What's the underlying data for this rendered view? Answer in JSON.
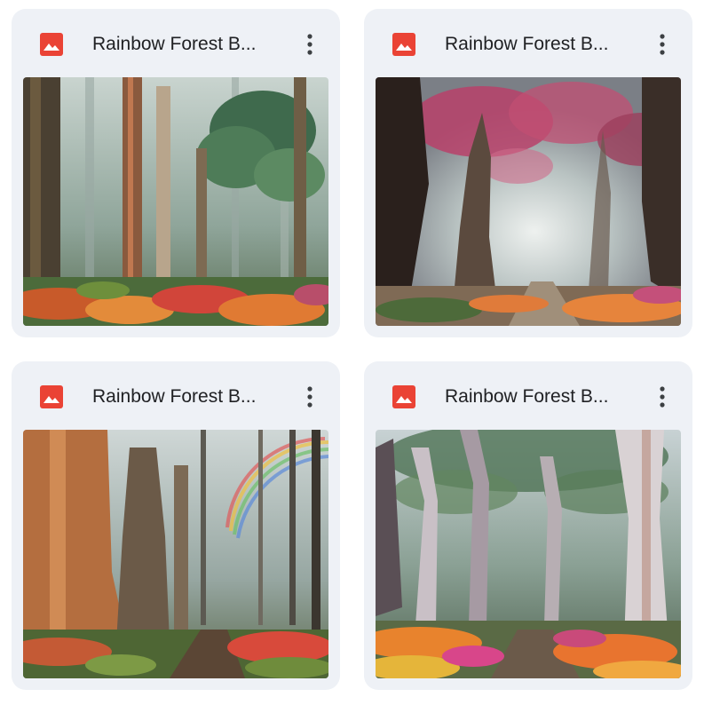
{
  "files": [
    {
      "title": "Rainbow Forest B...",
      "type_icon": "image-file-icon",
      "menu_icon": "more-vert-icon",
      "thumbnail": "tall eucalyptus forest with red and orange undergrowth"
    },
    {
      "title": "Rainbow Forest B...",
      "type_icon": "image-file-icon",
      "menu_icon": "more-vert-icon",
      "thumbnail": "misty path under pink-blossom trees"
    },
    {
      "title": "Rainbow Forest B...",
      "type_icon": "image-file-icon",
      "menu_icon": "more-vert-icon",
      "thumbnail": "giant trunks with rainbow and dirt trail"
    },
    {
      "title": "Rainbow Forest B...",
      "type_icon": "image-file-icon",
      "menu_icon": "more-vert-icon",
      "thumbnail": "white gum trees with colorful flower path"
    }
  ],
  "colors": {
    "card_bg": "#eef1f6",
    "icon_red": "#ea4335",
    "title_text": "#202124",
    "menu_dots": "#3c4043"
  }
}
